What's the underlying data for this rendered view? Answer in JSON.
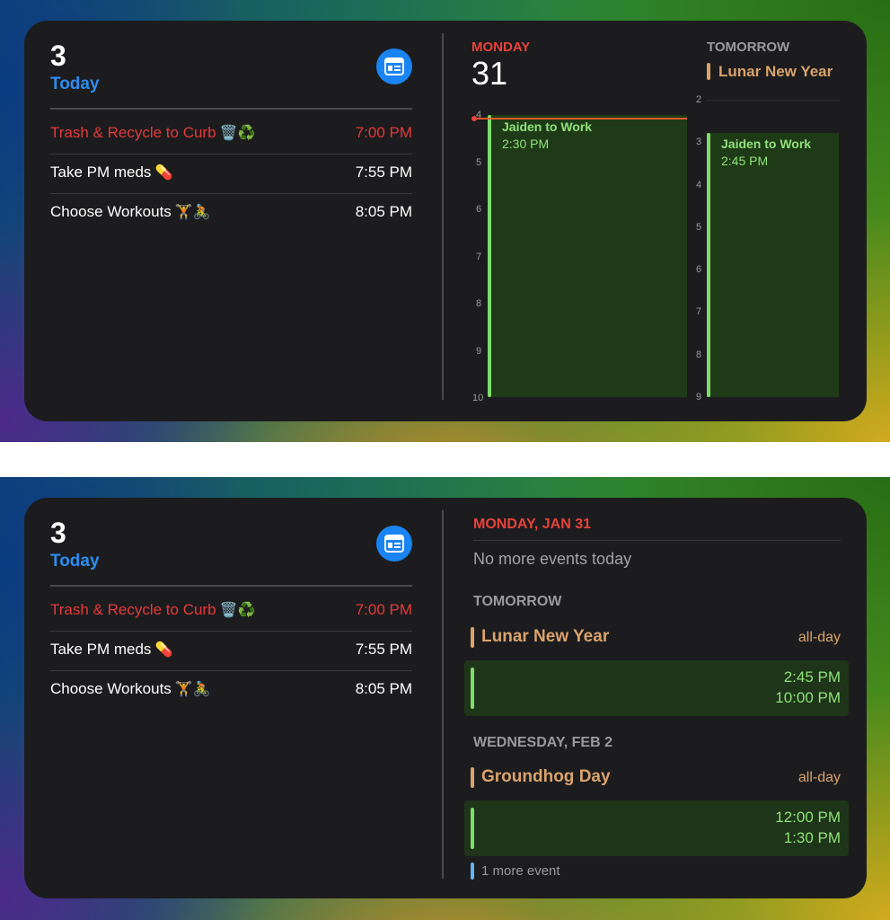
{
  "widget_top": {
    "reminders": {
      "count": "3",
      "today_label": "Today",
      "app_icon": "calendar-card-icon",
      "items": [
        {
          "title": "Trash & Recycle to Curb",
          "emoji": "🗑️♻️",
          "time": "7:00 PM",
          "overdue": true
        },
        {
          "title": "Take PM meds",
          "emoji": "💊",
          "time": "7:55 PM",
          "overdue": false
        },
        {
          "title": "Choose Workouts",
          "emoji": "🏋️🚴",
          "time": "8:05 PM",
          "overdue": false
        }
      ]
    },
    "calendar": {
      "today_weekday": "MONDAY",
      "today_day": "31",
      "today_hours": [
        "4",
        "5",
        "6",
        "7",
        "8",
        "9",
        "10"
      ],
      "today_event": {
        "title": "Jaiden to Work",
        "time": "2:30 PM"
      },
      "tomorrow_label": "TOMORROW",
      "tomorrow_allday": "Lunar New Year",
      "tomorrow_hours": [
        "2",
        "3",
        "4",
        "5",
        "6",
        "7",
        "8",
        "9"
      ],
      "tomorrow_event": {
        "title": "Jaiden to Work",
        "time": "2:45 PM"
      },
      "accent_color": "#e8433a",
      "event_color": "#8fe27a",
      "allday_color": "#d9a36b"
    }
  },
  "widget_bottom": {
    "reminders": {
      "count": "3",
      "today_label": "Today",
      "app_icon": "calendar-card-icon",
      "items": [
        {
          "title": "Trash & Recycle to Curb",
          "emoji": "🗑️♻️",
          "time": "7:00 PM",
          "overdue": true
        },
        {
          "title": "Take PM meds",
          "emoji": "💊",
          "time": "7:55 PM",
          "overdue": false
        },
        {
          "title": "Choose Workouts",
          "emoji": "🏋️🚴",
          "time": "8:05 PM",
          "overdue": false
        }
      ]
    },
    "calendar": {
      "today_header": "MONDAY, JAN 31",
      "no_events": "No more events today",
      "tomorrow_header": "TOMORROW",
      "tomorrow_allday": {
        "title": "Lunar New Year",
        "tag": "all-day"
      },
      "tomorrow_event": {
        "start": "2:45 PM",
        "end": "10:00 PM"
      },
      "wed_header": "WEDNESDAY, FEB 2",
      "wed_allday": {
        "title": "Groundhog Day",
        "tag": "all-day"
      },
      "wed_event": {
        "start": "12:00 PM",
        "end": "1:30 PM"
      },
      "more_events": "1 more event"
    }
  }
}
